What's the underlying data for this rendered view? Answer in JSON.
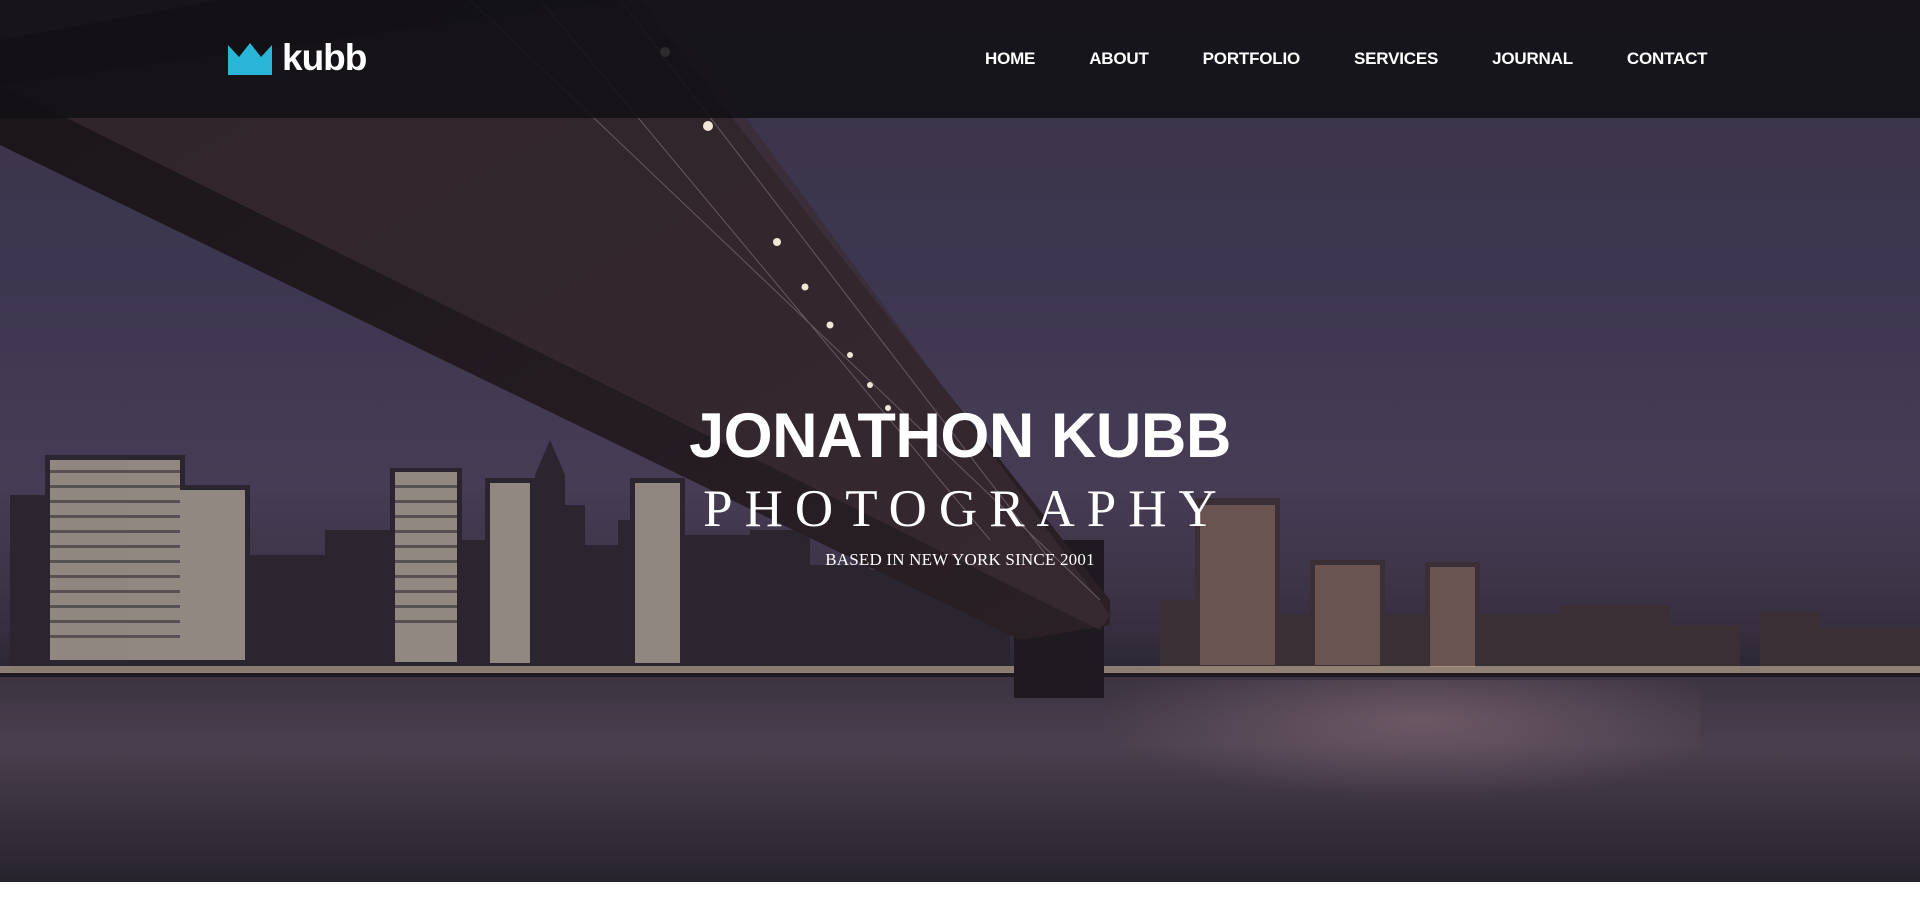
{
  "brand": {
    "logo_text": "kubb",
    "logo_icon": "crown-icon",
    "accent_color": "#29b6d8"
  },
  "nav": {
    "items": [
      "HOME",
      "ABOUT",
      "PORTFOLIO",
      "SERVICES",
      "JOURNAL",
      "CONTACT"
    ]
  },
  "hero": {
    "title": "JONATHON KUBB",
    "subtitle": "PHOTOGRAPHY",
    "tagline": "BASED IN NEW YORK SINCE 2001",
    "background_image": "night-bridge-skyline-photo"
  }
}
